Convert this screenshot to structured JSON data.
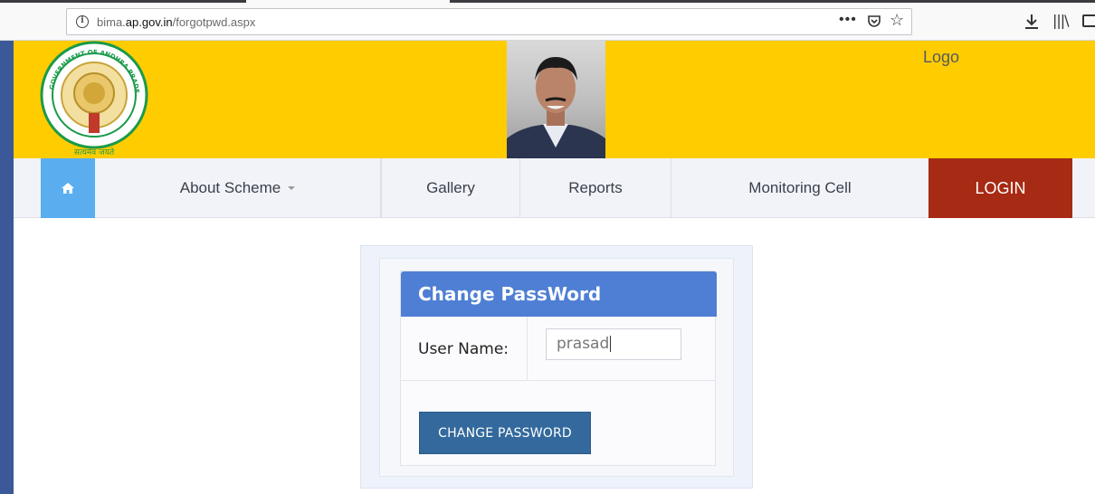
{
  "browser": {
    "url_prefix": "bima.",
    "url_domain": "ap.gov.in",
    "url_path": "/forgotpwd.aspx",
    "menu_icon": "ellipsis-icon",
    "pocket_icon": "pocket-icon",
    "star_icon": "bookmark-star-icon",
    "download_icon": "download-icon",
    "library_icon": "library-icon",
    "sidebar_icon": "sidebar-icon"
  },
  "header": {
    "emblem_icon": "andhra-pradesh-emblem",
    "emblem_top_text": "GOVERNMENT OF ANDHRA PRADESH",
    "emblem_bottom_text": "सत्यमेव जयते",
    "logo_text": "Logo",
    "bg_color": "#ffcc00"
  },
  "nav": {
    "home_icon": "home-icon",
    "items": [
      {
        "label": "About Scheme",
        "has_dropdown": true
      },
      {
        "label": "Gallery"
      },
      {
        "label": "Reports"
      },
      {
        "label": "Monitoring Cell"
      }
    ],
    "login_label": "LOGIN",
    "login_color": "#a72a14",
    "home_color": "#5aaef0"
  },
  "form": {
    "title": "Change PassWord",
    "user_label": "User Name:",
    "user_value": "prasad",
    "submit_label": "CHANGE PASSWORD",
    "header_color": "#4f7fd4",
    "button_color": "#33699d"
  }
}
